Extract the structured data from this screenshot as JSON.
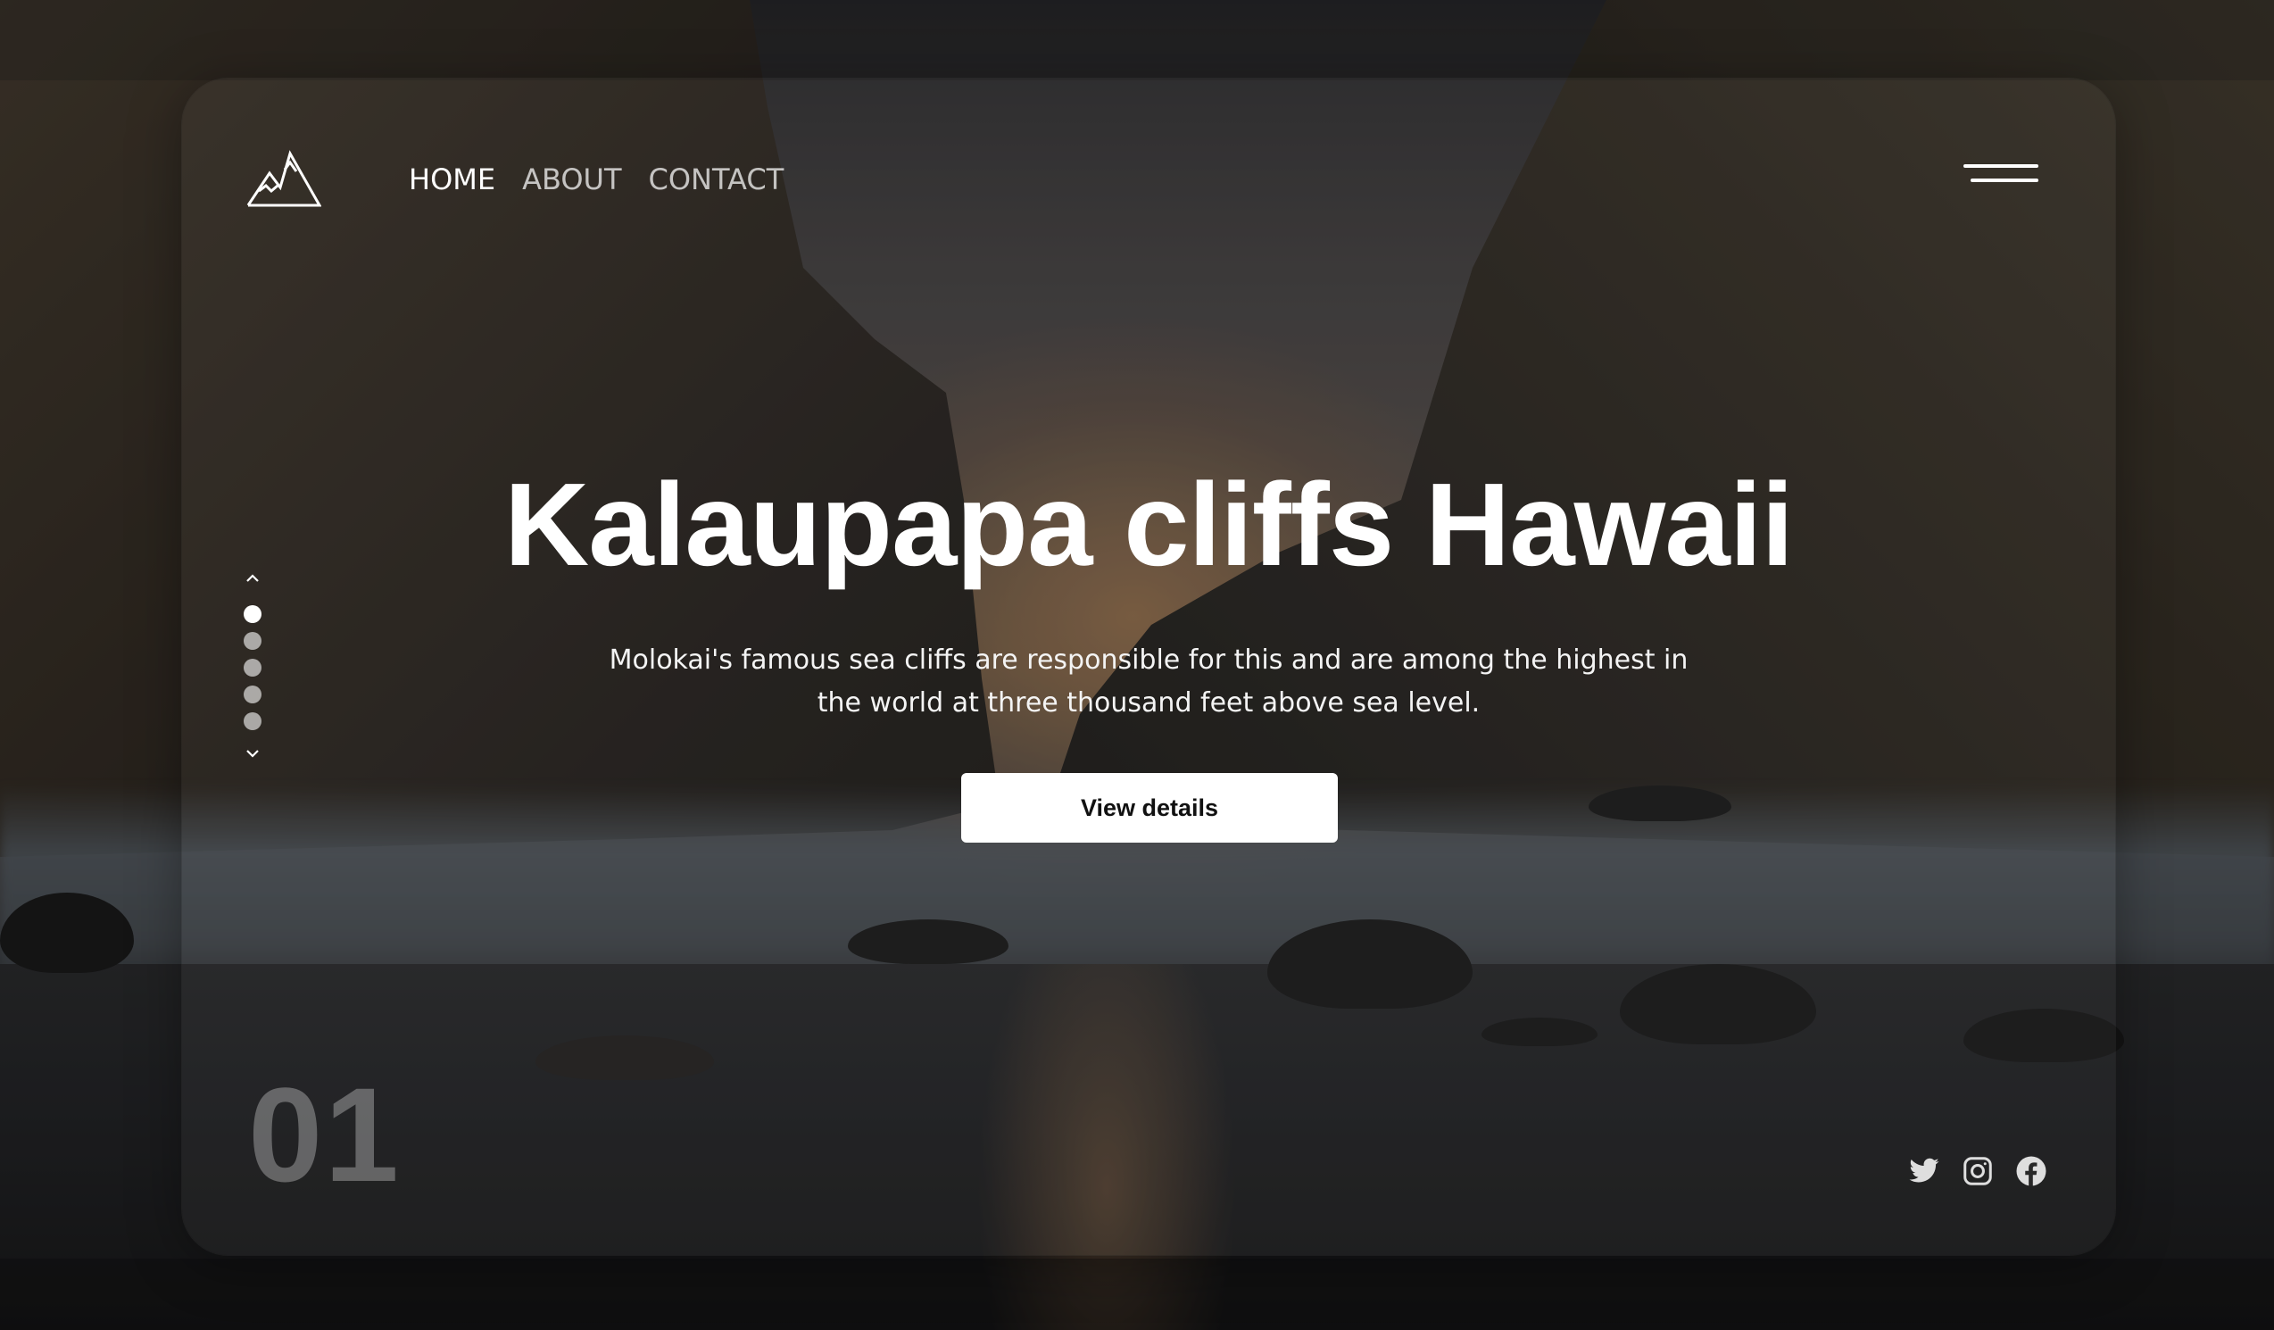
{
  "nav": {
    "items": [
      {
        "label": "HOME",
        "active": true
      },
      {
        "label": "ABOUT",
        "active": false
      },
      {
        "label": "CONTACT",
        "active": false
      }
    ]
  },
  "hero": {
    "title": "Kalaupapa cliffs Hawaii",
    "description": "Molokai's famous sea cliffs are responsible for this and are among the highest in the world at three thousand feet above sea level.",
    "cta_label": "View details"
  },
  "pager": {
    "total_slides": 5,
    "active_index": 0
  },
  "slide_number": "01",
  "icons": {
    "logo": "mountain-logo-icon",
    "menu": "hamburger-menu-icon",
    "pager_prev": "chevron-up-icon",
    "pager_next": "chevron-down-icon",
    "social": [
      "twitter-icon",
      "instagram-icon",
      "facebook-icon"
    ]
  },
  "colors": {
    "text": "#ffffff",
    "muted_nav": "#b8b8b8",
    "cta_bg": "#ffffff",
    "cta_text": "#111111"
  }
}
